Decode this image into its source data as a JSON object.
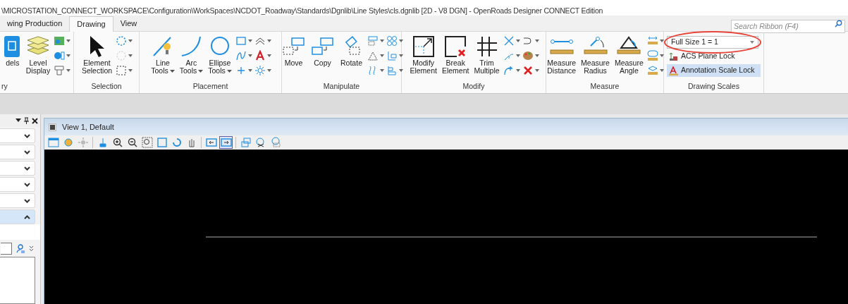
{
  "window": {
    "title": "\\MICROSTATION_CONNECT_WORKSPACE\\Configuration\\WorkSpaces\\NCDOT_Roadway\\Standards\\Dgnlib\\Line Styles\\cls.dgnlib [2D - V8 DGN] - OpenRoads Designer CONNECT Edition"
  },
  "tabs": [
    {
      "label": "wing Production",
      "selected": false
    },
    {
      "label": "Drawing",
      "selected": true
    },
    {
      "label": "View",
      "selected": false
    }
  ],
  "search": {
    "placeholder": "Search Ribbon (F4)"
  },
  "ribbon_groups": [
    {
      "label": "ry",
      "buttons": [
        {
          "lines": [
            "dels"
          ],
          "dropdown": false
        },
        {
          "lines": [
            "Level",
            "Display"
          ],
          "dropdown": false
        }
      ]
    },
    {
      "label": "Selection",
      "buttons": [
        {
          "lines": [
            "Element",
            "Selection"
          ],
          "dropdown": false
        }
      ]
    },
    {
      "label": "Placement",
      "buttons": [
        {
          "lines": [
            "Line",
            "Tools"
          ],
          "dropdown": true
        },
        {
          "lines": [
            "Arc",
            "Tools"
          ],
          "dropdown": true
        },
        {
          "lines": [
            "Ellipse",
            "Tools"
          ],
          "dropdown": true
        }
      ]
    },
    {
      "label": "Manipulate",
      "buttons": [
        {
          "lines": [
            "Move"
          ],
          "dropdown": false
        },
        {
          "lines": [
            "Copy"
          ],
          "dropdown": false
        },
        {
          "lines": [
            "Rotate"
          ],
          "dropdown": false
        }
      ]
    },
    {
      "label": "Modify",
      "buttons": [
        {
          "lines": [
            "Modify",
            "Element"
          ],
          "dropdown": false
        },
        {
          "lines": [
            "Break",
            "Element"
          ],
          "dropdown": false
        },
        {
          "lines": [
            "Trim",
            "Multiple"
          ],
          "dropdown": false
        }
      ]
    },
    {
      "label": "Measure",
      "buttons": [
        {
          "lines": [
            "Measure",
            "Distance"
          ],
          "dropdown": false
        },
        {
          "lines": [
            "Measure",
            "Radius"
          ],
          "dropdown": false
        },
        {
          "lines": [
            "Measure",
            "Angle"
          ],
          "dropdown": false
        }
      ]
    },
    {
      "label": "Drawing Scales",
      "scale_value": "Full Size 1 = 1",
      "locks": [
        {
          "label": "ACS Plane Lock",
          "selected": false
        },
        {
          "label": "Annotation Scale Lock",
          "selected": true
        }
      ]
    }
  ],
  "panel": {
    "sections": [
      {
        "expanded": false
      },
      {
        "expanded": false
      },
      {
        "expanded": false
      },
      {
        "expanded": false
      },
      {
        "expanded": false
      },
      {
        "expanded": true
      }
    ]
  },
  "view": {
    "title": "View 1, Default",
    "toolbar": [
      {
        "selected": false
      },
      {
        "selected": false
      },
      {
        "selected": false
      },
      {
        "selected": false
      },
      {
        "selected": false
      },
      {
        "selected": false
      },
      {
        "selected": false
      },
      {
        "selected": false
      },
      {
        "selected": false
      },
      {
        "selected": false
      },
      {
        "selected": false
      },
      {
        "selected": true
      },
      {
        "selected": false
      },
      {
        "selected": false
      },
      {
        "selected": false
      }
    ]
  }
}
